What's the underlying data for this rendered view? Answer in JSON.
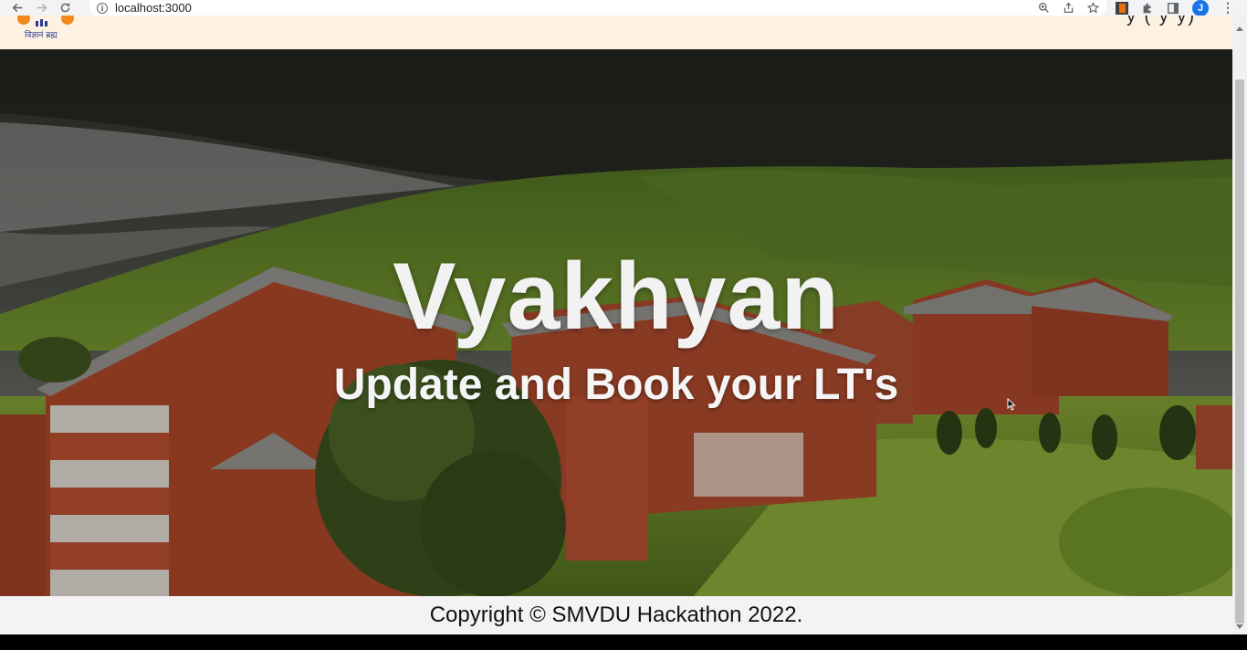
{
  "browser": {
    "url": "localhost:3000",
    "profile_initial": "J"
  },
  "header": {
    "logo_tagline": "विज्ञानं ब्रह्म",
    "nav_text_cropped": "y (    y   y)"
  },
  "hero": {
    "title": "Vyakhyan",
    "subtitle": "Update and Book your LT's"
  },
  "footer": {
    "copyright": "Copyright © SMVDU Hackathon 2022."
  },
  "colors": {
    "header_bg": "#fdf1e2",
    "footer_bg": "#f3f3f3",
    "hero_text": "#f2f2f2",
    "logo_orange": "#f08a1c",
    "logo_blue": "#2b3a8c"
  }
}
